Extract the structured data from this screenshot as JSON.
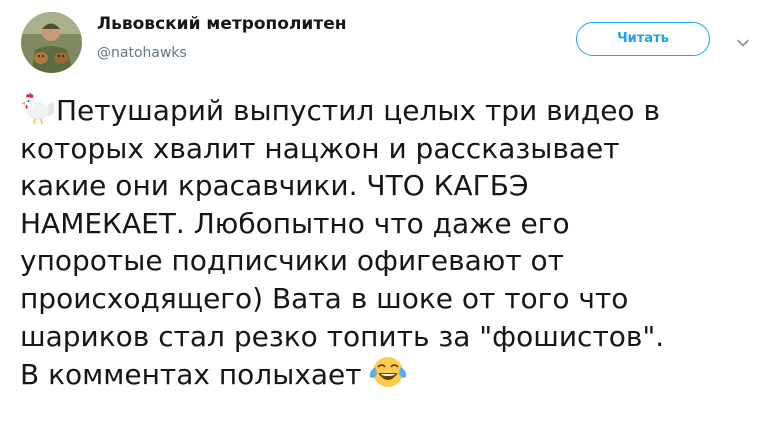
{
  "account": {
    "display_name": "Львовский метрополитен",
    "handle": "@natohawks"
  },
  "follow_button": {
    "label": "Читать"
  },
  "menu": {
    "icon": "chevron-down-icon"
  },
  "tweet": {
    "emoji_start": "rooster-emoji",
    "lines": [
      "Петушарий выпустил целых три видео в",
      "которых хвалит нацжон и рассказывает",
      "какие они красавчики. ЧТО КАГБЭ",
      "НАМЕКАЕТ. Любопытно что даже его",
      "упоротые подписчики офигевают от",
      "происходящего) Вата в шоке от того что",
      "шариков стал резко топить за \"фошистов\".",
      "В комментах полыхает"
    ],
    "emoji_end": "tears-of-joy-emoji"
  },
  "colors": {
    "accent": "#1da1f2",
    "text": "#14171a",
    "secondary": "#657786"
  }
}
